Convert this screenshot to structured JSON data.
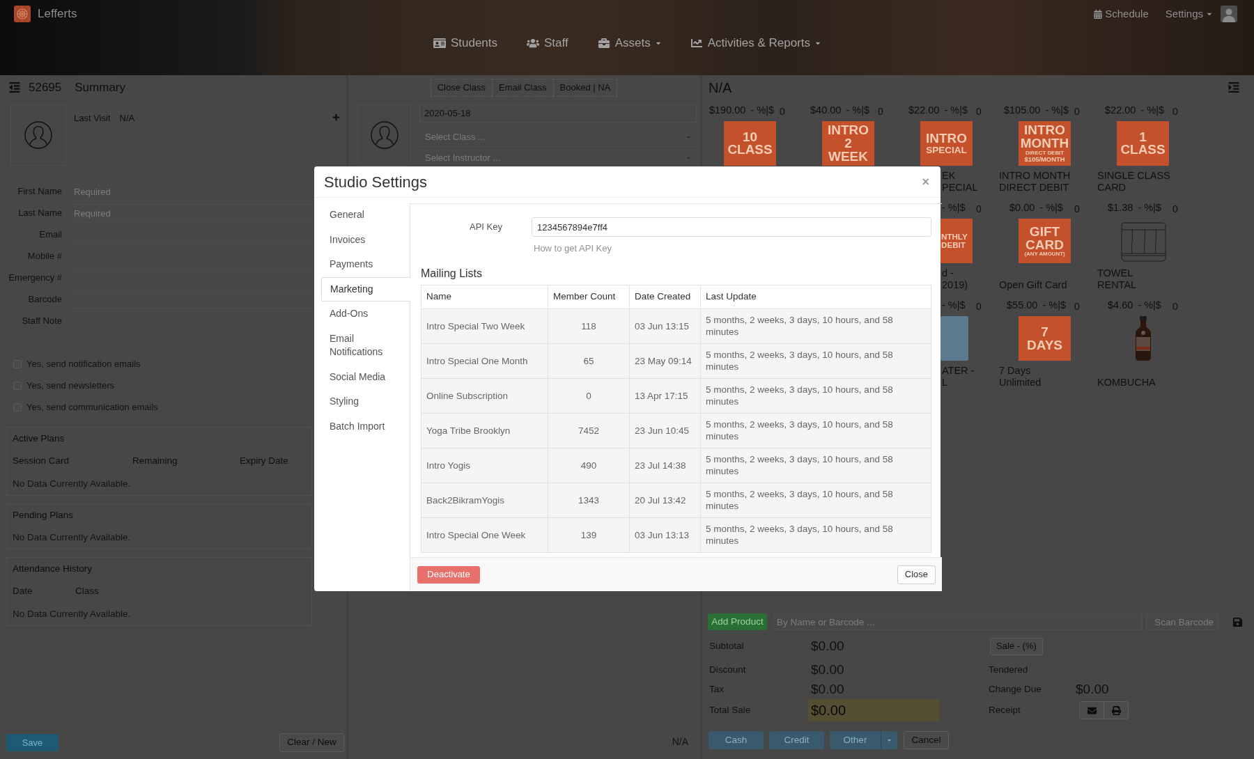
{
  "header": {
    "brand": "Lefferts",
    "nav": [
      {
        "label": "Students",
        "dropdown": false
      },
      {
        "label": "Staff",
        "dropdown": false
      },
      {
        "label": "Assets",
        "dropdown": true
      },
      {
        "label": "Activities & Reports",
        "dropdown": true
      }
    ],
    "schedule": "Schedule",
    "settings": {
      "label": "Settings",
      "dropdown": true
    }
  },
  "customer": {
    "record_id": "52695",
    "title": "Summary",
    "last_visit_label": "Last Visit",
    "last_visit": "N/A",
    "fields": [
      {
        "label": "First Name",
        "placeholder": "Required"
      },
      {
        "label": "Last Name",
        "placeholder": "Required"
      },
      {
        "label": "Email"
      },
      {
        "label": "Mobile #"
      },
      {
        "label": "Emergency #"
      },
      {
        "label": "Barcode"
      },
      {
        "label": "Staff Note"
      }
    ],
    "checkboxes": [
      {
        "label": "Yes, send notification emails",
        "checked": false
      },
      {
        "label": "Yes, send newsletters",
        "checked": false
      },
      {
        "label": "Yes, send communication emails",
        "checked": false
      }
    ],
    "sections": [
      {
        "title": "Active Plans",
        "columns": [
          "Session Card",
          "Remaining",
          "Expiry Date"
        ],
        "empty": "No Data Currently Available."
      },
      {
        "title": "Pending Plans",
        "empty": "No Data Currently Available."
      },
      {
        "title": "Attendance History",
        "columns": [
          "Date",
          "Class"
        ],
        "empty": "No Data Currently Available."
      }
    ],
    "save": "Save",
    "clear": "Clear / New"
  },
  "booking": {
    "actions": [
      "Close Class",
      "Email Class",
      "Booked | NA"
    ],
    "date": "2020-05-18",
    "selects": [
      {
        "placeholder": "Select Class ..."
      },
      {
        "placeholder": "Select Instructor ..."
      }
    ],
    "footer": "N/A"
  },
  "sales": {
    "title": "N/A",
    "product_rows": [
      [
        {
          "price": "$190.00",
          "discount": "- %|$",
          "qty": "0",
          "kind": "tile",
          "tile_text": [
            "10",
            "CLASS"
          ]
        },
        {
          "price": "$40.00",
          "discount": "- %|$",
          "qty": "0",
          "kind": "tile",
          "tile_text": [
            "INTRO",
            "2",
            "WEEK"
          ]
        },
        {
          "price": "$22.00",
          "discount": "- %|$",
          "qty": "0",
          "kind": "tile",
          "tile_text": [
            "INTRO",
            "SPECIAL"
          ],
          "label": [
            "EK",
            "PECIAL"
          ],
          "cut": true
        },
        {
          "price": "$105.00",
          "discount": "- %|$",
          "qty": "0",
          "kind": "tile",
          "tile_text": [
            "INTRO",
            "MONTH",
            "DIRECT DEBIT",
            "$105/MONTH"
          ],
          "label": [
            "INTRO MONTH",
            "DIRECT DEBIT"
          ]
        },
        {
          "price": "$22.00",
          "discount": "- %|$",
          "qty": "0",
          "kind": "tile",
          "tile_text": [
            "1",
            "CLASS"
          ],
          "label": [
            "SINGLE CLASS",
            "CARD"
          ]
        }
      ],
      [
        {
          "discount": "- %|$",
          "qty": "0",
          "kind": "tile",
          "tile_text": [
            "NTHLY",
            "DEBIT"
          ],
          "label": [
            "d -",
            "2019)"
          ],
          "cut": true
        },
        {
          "price": "$0.00",
          "discount": "- %|$",
          "qty": "0",
          "kind": "tile",
          "tile_text": [
            "GIFT",
            "CARD",
            "(ANY AMOUNT)"
          ],
          "label": [
            "Open Gift Card"
          ]
        },
        {
          "price": "$1.38",
          "discount": "- %|$",
          "qty": "0",
          "kind": "towel",
          "label": [
            "TOWEL",
            "RENTAL"
          ]
        }
      ],
      [
        {
          "discount": "- %|$",
          "qty": "0",
          "kind": "photo",
          "label": [
            "ATER -",
            "L"
          ],
          "cut": true
        },
        {
          "price": "$55.00",
          "discount": "- %|$",
          "qty": "0",
          "kind": "tile",
          "tile_text": [
            "7",
            "DAYS"
          ],
          "label": [
            "7 Days",
            "Unlimited"
          ]
        },
        {
          "price": "$4.60",
          "discount": "- %|$",
          "qty": "0",
          "kind": "bottle",
          "label": [
            "KOMBUCHA"
          ]
        }
      ]
    ],
    "add_product": "Add Product",
    "search_placeholder": "By Name or Barcode ...",
    "scan_placeholder": "Scan Barcode",
    "totals": [
      {
        "label": "Subtotal",
        "value": "$0.00",
        "kind": "line"
      },
      {
        "label": "Discount",
        "value": "$0.00",
        "kind": "line"
      },
      {
        "label": "Tax",
        "value": "$0.00",
        "kind": "line"
      },
      {
        "label": "Total Sale",
        "value": "$0.00",
        "kind": "total"
      }
    ],
    "discount_button": "Sale - (%)",
    "tendered_label": "Tendered",
    "change_label": "Change Due",
    "change_value": "$0.00",
    "receipt_label": "Receipt",
    "payments": [
      "Cash",
      "Credit",
      "Other"
    ],
    "cancel": "Cancel"
  },
  "modal": {
    "title": "Studio Settings",
    "close": "×",
    "nav": [
      {
        "label": "General",
        "selected": false
      },
      {
        "label": "Invoices",
        "selected": false
      },
      {
        "label": "Payments",
        "selected": false
      },
      {
        "label": "Marketing",
        "selected": true
      },
      {
        "label": "Add-Ons",
        "selected": false
      },
      {
        "label": "Email Notifications",
        "selected": false
      },
      {
        "label": "Social Media",
        "selected": false
      },
      {
        "label": "Styling",
        "selected": false
      },
      {
        "label": "Batch Import",
        "selected": false
      }
    ],
    "api_key": {
      "label": "API Key",
      "value": "1234567894e7ff4",
      "help_link": "How to get API Key"
    },
    "mailing_lists": {
      "title": "Mailing Lists",
      "columns": [
        "Name",
        "Member Count",
        "Date Created",
        "Last Update"
      ],
      "rows": [
        [
          "Intro Special Two Week",
          "118",
          "03 Jun 13:15",
          "5 months, 2 weeks, 3 days, 10 hours, and 58 minutes"
        ],
        [
          "Intro Special One Month",
          "65",
          "23 May 09:14",
          "5 months, 2 weeks, 3 days, 10 hours, and 58 minutes"
        ],
        [
          "Online Subscription",
          "0",
          "13 Apr 17:15",
          "5 months, 2 weeks, 3 days, 10 hours, and 58 minutes"
        ],
        [
          "Yoga Tribe Brooklyn",
          "7452",
          "23 Jun 10:45",
          "5 months, 2 weeks, 3 days, 10 hours, and 58 minutes"
        ],
        [
          "Intro Yogis",
          "490",
          "23 Jul 14:38",
          "5 months, 2 weeks, 3 days, 10 hours, and 58 minutes"
        ],
        [
          "Back2BikramYogis",
          "1343",
          "20 Jul 13:42",
          "5 months, 2 weeks, 3 days, 10 hours, and 58 minutes"
        ],
        [
          "Intro Special One Week",
          "139",
          "03 Jun 13:13",
          "5 months, 2 weeks, 3 days, 10 hours, and 58 minutes"
        ]
      ]
    },
    "deactivate": "Deactivate",
    "close_button": "Close"
  }
}
